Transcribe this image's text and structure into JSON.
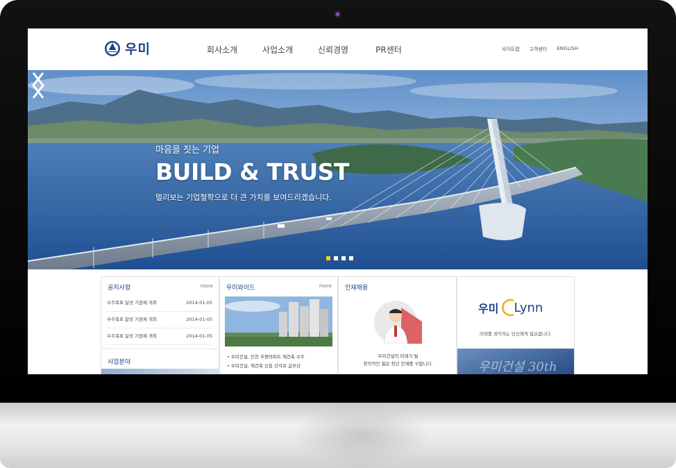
{
  "header": {
    "logo_text": "우미",
    "nav": [
      "회사소개",
      "사업소개",
      "신뢰경영",
      "PR센터"
    ],
    "util": [
      "사이트맵",
      "고객센터",
      "ENGLISH"
    ]
  },
  "hero": {
    "subtitle": "마음을 짓는 기업",
    "title": "BUILD & TRUST",
    "description": "멀리보는 기업철학으로 더 큰 가치를 보여드리겠습니다.",
    "slides": 4,
    "active_slide": 1
  },
  "notice": {
    "title": "공지사항",
    "more": "more",
    "items": [
      {
        "text": "수주목표 달성 기원제 개최",
        "date": "2014-01-05"
      },
      {
        "text": "수주목표 달성 기원제 개최",
        "date": "2014-01-05"
      },
      {
        "text": "수주목표 달성 기원제 개최",
        "date": "2014-01-05"
      }
    ]
  },
  "business": {
    "title": "사업분야"
  },
  "wide": {
    "title": "우미와이드",
    "more": "more",
    "items": [
      "우미건설, 인천 부평아파트 재건축 수주",
      "우미건설, 재건축 신흥 강자로 급부상"
    ]
  },
  "recruit": {
    "title": "인재채용",
    "lines": [
      "우미건설의 미래가 될",
      "창의적인 젊은 청년 인재를 구합니다."
    ]
  },
  "lynn": {
    "brand_kr": "우미",
    "brand_en": "Lynn",
    "description": "미래를 생각하는 당신에게 필요합니다.",
    "banner_text": "우미건설 30th"
  }
}
